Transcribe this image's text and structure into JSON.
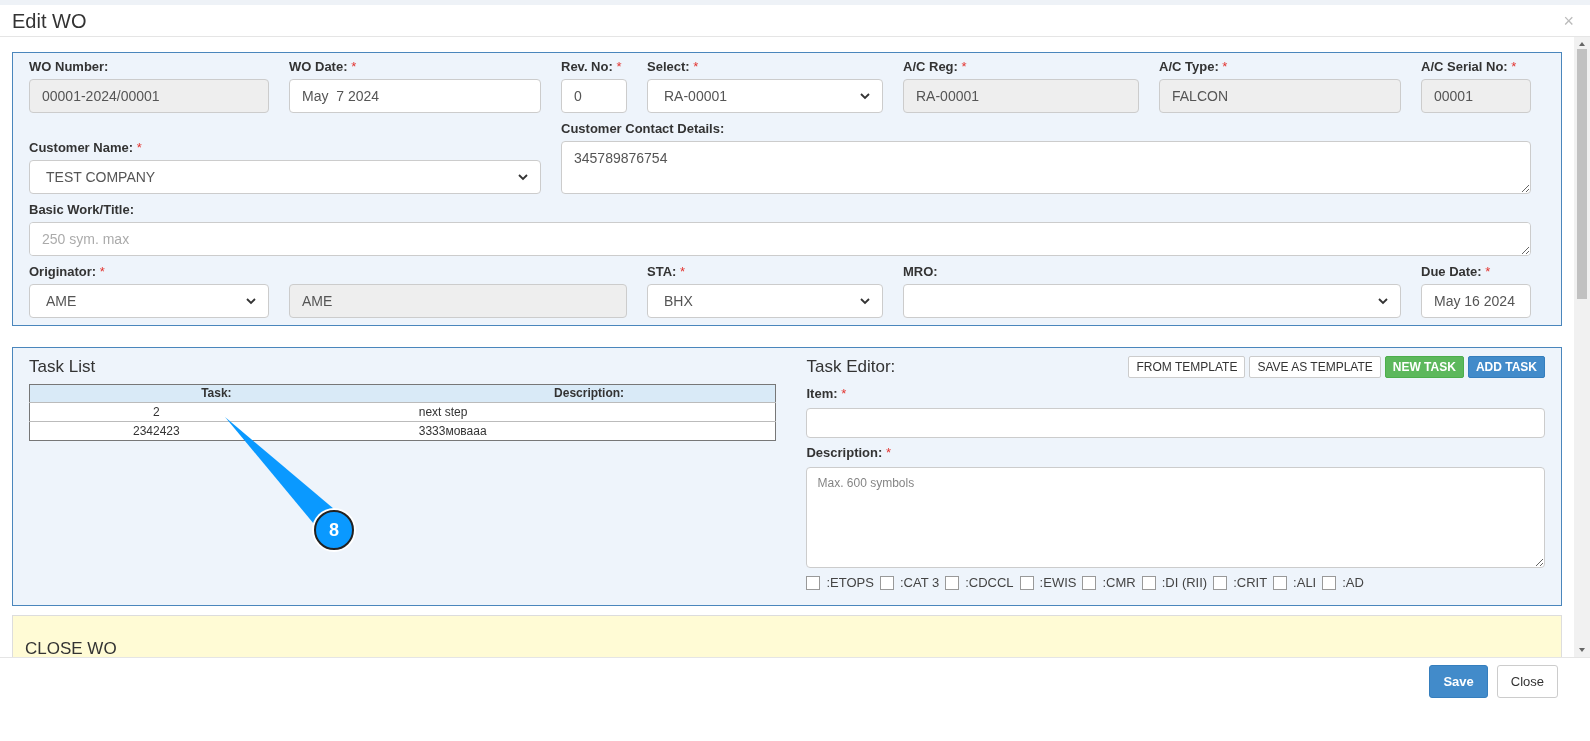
{
  "modal": {
    "title": "Edit WO",
    "close_symbol": "×"
  },
  "required_mark": "*",
  "wo_fields": [
    {
      "label": "WO Number:",
      "required": false,
      "kind": "readonly",
      "value": "00001-2024/00001"
    },
    {
      "label": "WO Date:",
      "required": true,
      "kind": "input",
      "value": "May  7 2024"
    },
    {
      "label": "Rev. No:",
      "required": true,
      "kind": "input",
      "value": "0"
    },
    {
      "label": "Select:",
      "required": true,
      "kind": "select",
      "value": "RA-00001"
    },
    {
      "label": "A/C Reg:",
      "required": true,
      "kind": "readonly",
      "value": "RA-00001"
    },
    {
      "label": "A/C Type:",
      "required": true,
      "kind": "readonly",
      "value": "FALCON"
    },
    {
      "label": "A/C Serial No:",
      "required": true,
      "kind": "readonly",
      "value": "00001"
    },
    {
      "label": "Customer Name:",
      "required": true,
      "kind": "select",
      "value": "TEST COMPANY"
    },
    {
      "label": "Customer Contact Details:",
      "required": false,
      "kind": "textarea",
      "value": "345789876754"
    },
    {
      "label": "Basic Work/Title:",
      "required": false,
      "kind": "textarea",
      "placeholder": "250 sym. max"
    },
    {
      "label": "Originator:",
      "required": true,
      "kind": "select",
      "value": "AME"
    },
    {
      "kind": "readonly",
      "value": "AME"
    },
    {
      "label": "STA:",
      "required": true,
      "kind": "select",
      "value": "BHX"
    },
    {
      "label": "MRO:",
      "required": false,
      "kind": "select"
    },
    {
      "label": "Due Date:",
      "required": true,
      "kind": "input",
      "value": "May 16 2024"
    }
  ],
  "task_list": {
    "title": "Task List",
    "columns": [
      "Task:",
      "Description:"
    ],
    "rows": [
      [
        "2",
        "next step"
      ],
      [
        "2342423",
        "3333мовааа"
      ]
    ]
  },
  "task_editor": {
    "title": "Task Editor:",
    "buttons": [
      {
        "label": "FROM TEMPLATE",
        "kind": "outline"
      },
      {
        "label": "SAVE AS TEMPLATE",
        "kind": "outline"
      },
      {
        "label": "NEW TASK",
        "kind": "success"
      },
      {
        "label": "ADD TASK",
        "kind": "primary"
      }
    ],
    "item": {
      "label": "Item:",
      "required": true
    },
    "description": {
      "label": "Description:",
      "required": true,
      "placeholder": "Max. 600 symbols"
    },
    "flags": [
      {
        "label": ":ETOPS",
        "checked": false
      },
      {
        "label": ":CAT 3",
        "checked": false
      },
      {
        "label": ":CDCCL",
        "checked": false
      },
      {
        "label": ":EWIS",
        "checked": false
      },
      {
        "label": ":CMR",
        "checked": false
      },
      {
        "label": ":DI (RII)",
        "checked": false
      },
      {
        "label": ":CRIT",
        "checked": false
      },
      {
        "label": ":ALI",
        "checked": false
      },
      {
        "label": ":AD",
        "checked": false
      }
    ]
  },
  "close_section": {
    "title": "CLOSE WO"
  },
  "footer_buttons": [
    {
      "label": "Save",
      "kind": "primary"
    },
    {
      "label": "Close",
      "kind": "default"
    }
  ],
  "callout": {
    "label": "8"
  }
}
